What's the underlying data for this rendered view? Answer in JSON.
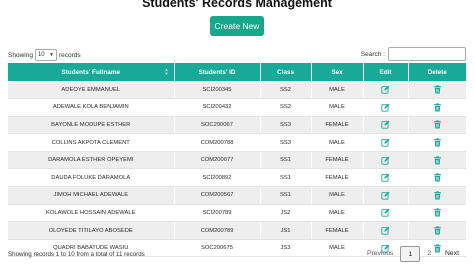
{
  "page": {
    "title": "Students' Records Management",
    "create_button": "Create New"
  },
  "toolbar": {
    "show_label": "Showing",
    "length_value": "10",
    "records_label": "records",
    "search_label": "Search :",
    "search_value": ""
  },
  "table": {
    "headers": {
      "fullname": "Students' Fullname",
      "id": "Students' ID",
      "class": "Class",
      "sex": "Sex",
      "edit": "Edit",
      "delete": "Delete"
    },
    "rows": [
      {
        "name": "ADEOYE EMMANUEL",
        "id": "SCI200345",
        "class": "SS2",
        "sex": "MALE"
      },
      {
        "name": "ADEWALE KOLA BENJAMIN",
        "id": "SCI200432",
        "class": "SS2",
        "sex": "MALE"
      },
      {
        "name": "BAYONLE MODUPE ESTHER",
        "id": "SOC200067",
        "class": "SS3",
        "sex": "FEMALE"
      },
      {
        "name": "COLLINS AKPOTA CLEMENT",
        "id": "COM200788",
        "class": "SS3",
        "sex": "MALE"
      },
      {
        "name": "DARAMOLA ESTHER OPEYEMI",
        "id": "COM200077",
        "class": "SS1",
        "sex": "FEMALE"
      },
      {
        "name": "DAUDA FOLUKE DARAMOLA",
        "id": "SCI200892",
        "class": "SS1",
        "sex": "FEMALE"
      },
      {
        "name": "JIMOH MICHAEL ADEWALE",
        "id": "COM200567",
        "class": "SS1",
        "sex": "MALE"
      },
      {
        "name": "KOLAWOLE HOSSAIN ADEWALE",
        "id": "SCI200789",
        "class": "JS2",
        "sex": "MALE"
      },
      {
        "name": "OLOYEDE TITILAYO ABOSEDE",
        "id": "COM200789",
        "class": "JS1",
        "sex": "FEMALE"
      },
      {
        "name": "QUADRI BABATUDE WASIU",
        "id": "SOC200675",
        "class": "JS3",
        "sex": "MALE"
      }
    ]
  },
  "footer": {
    "info": "Showing records 1 to 10 from a total of 11 records",
    "previous": "Previous",
    "pages": [
      "1",
      "2"
    ],
    "current_page": "1",
    "next": "Next"
  },
  "colors": {
    "accent": "#18a999",
    "button": "#17a88b"
  },
  "icons": {
    "edit": "pencil-square-icon",
    "delete": "trash-icon",
    "sort": "sort-arrows-icon"
  }
}
